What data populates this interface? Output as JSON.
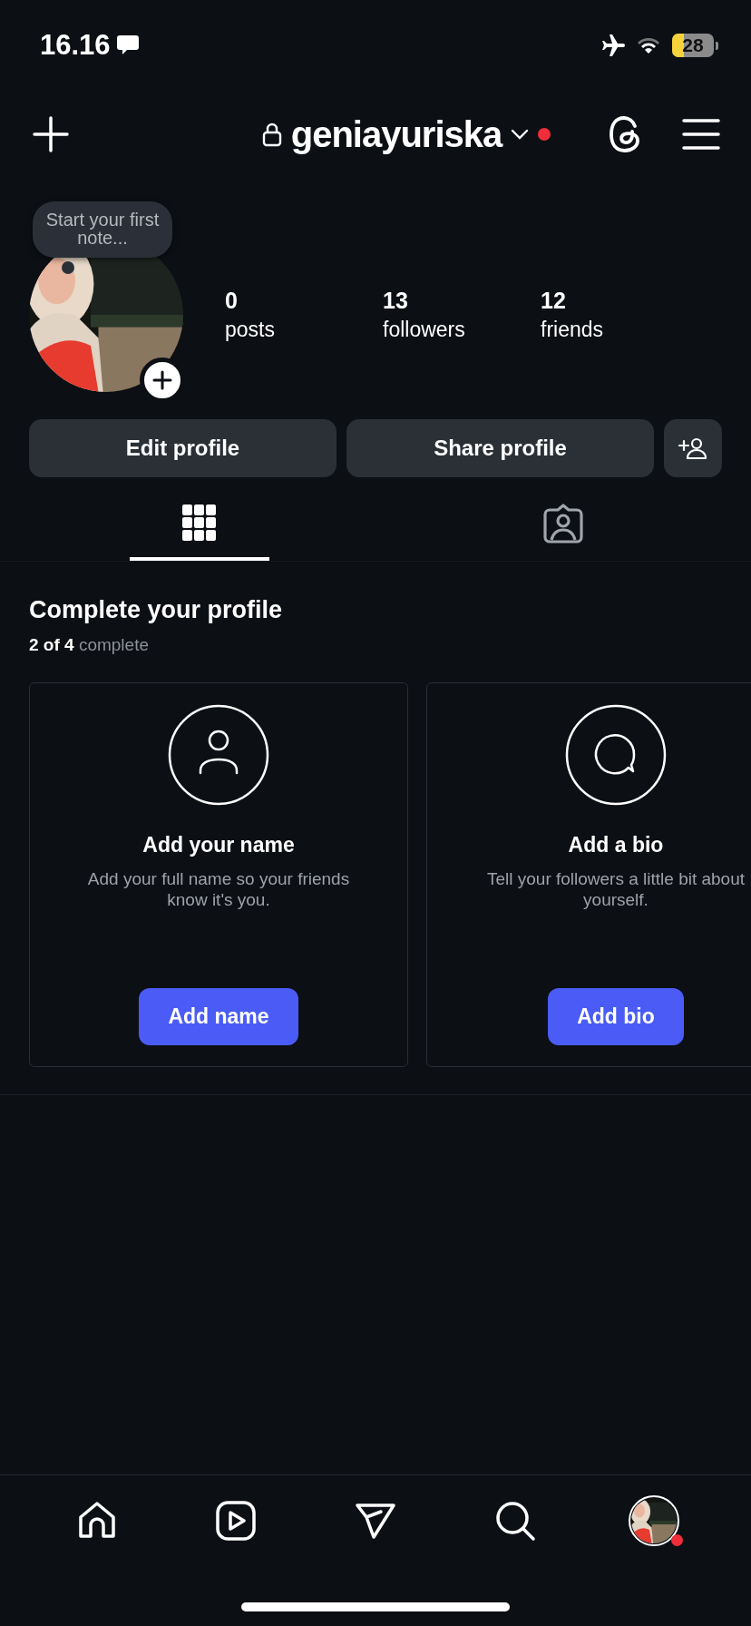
{
  "status_bar": {
    "time": "16.16",
    "battery": "28"
  },
  "header": {
    "username": "geniayuriska",
    "private": true,
    "has_notification": true
  },
  "note": {
    "placeholder": "Start your first note..."
  },
  "stats": [
    {
      "value": "0",
      "label": "posts"
    },
    {
      "value": "13",
      "label": "followers"
    },
    {
      "value": "12",
      "label": "friends"
    }
  ],
  "actions": [
    "Edit profile",
    "Share profile"
  ],
  "tabs": [
    {
      "kind": "grid",
      "selected": true
    },
    {
      "kind": "tagged",
      "selected": false
    }
  ],
  "complete_profile": {
    "title": "Complete your profile",
    "progress": "**2 of 4** complete",
    "cards": [
      {
        "kind": "name",
        "title": "Add your name",
        "text": "Add your full name so your friends know it's you.",
        "button": "Add name"
      },
      {
        "kind": "bio",
        "title": "Add a bio",
        "text": "Tell your followers a little bit about yourself.",
        "button": "Add bio"
      }
    ]
  },
  "nav": [
    {
      "kind": "home",
      "selected": false
    },
    {
      "kind": "reels",
      "selected": false
    },
    {
      "kind": "messages",
      "selected": false
    },
    {
      "kind": "search",
      "selected": false
    },
    {
      "kind": "profile",
      "selected": true,
      "has_notification": true
    }
  ]
}
